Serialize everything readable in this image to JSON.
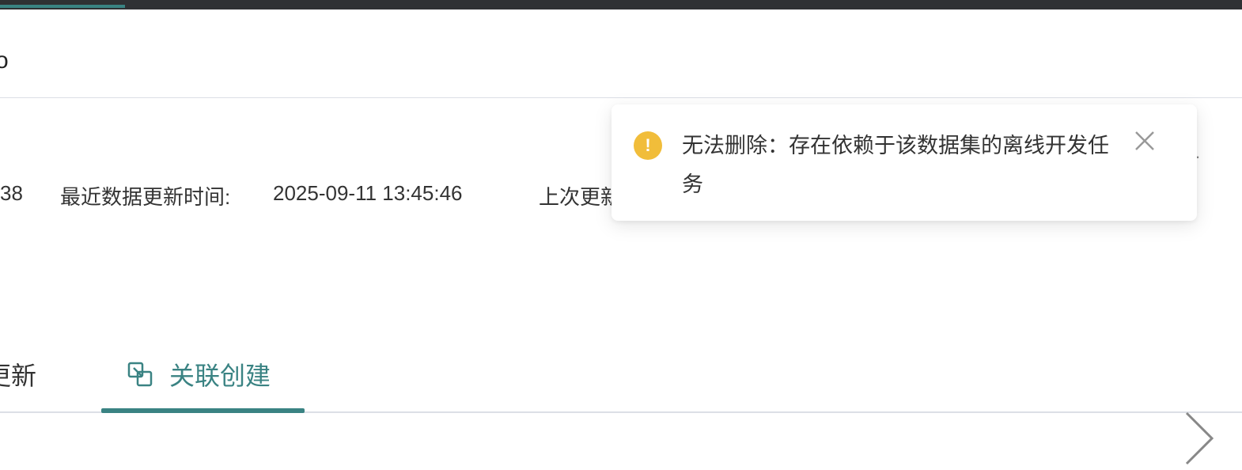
{
  "header": {
    "partial_title": "o"
  },
  "meta": {
    "value_1": "38",
    "recent_update_label": "最近数据更新时间:",
    "recent_update_value": "2025-09-11 13:45:46",
    "last_update_label": "上次更新"
  },
  "stray": {
    "dot": "."
  },
  "tabs": {
    "update_label": "更新",
    "link_label": "关联创建",
    "active": "关联创建"
  },
  "toast": {
    "type": "warning",
    "icon": "exclamation-icon",
    "message": "无法删除：存在依赖于该数据集的离线开发任务",
    "color": "#f1bd3a"
  },
  "colors": {
    "accent": "#3a8383",
    "topbar": "#2f3134"
  }
}
